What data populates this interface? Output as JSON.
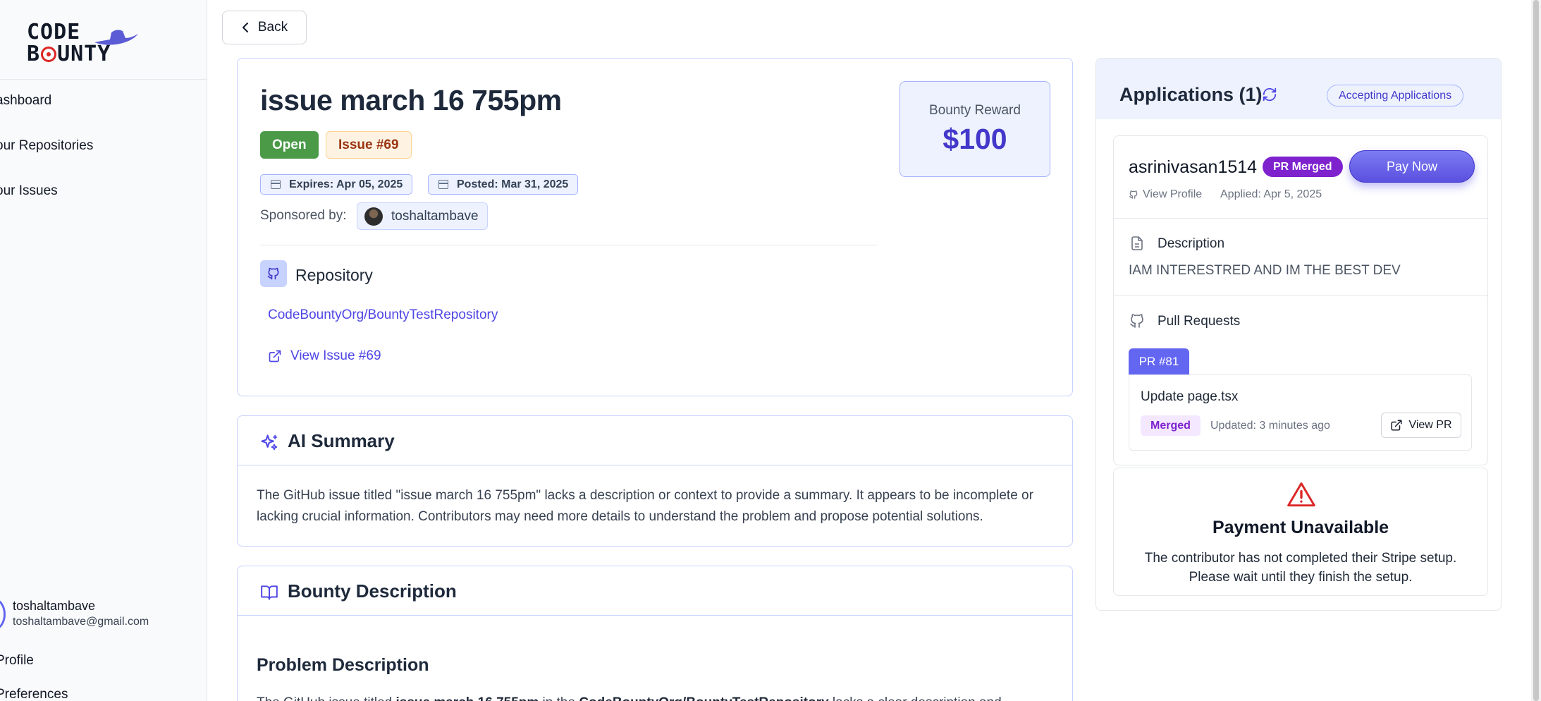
{
  "sidebar": {
    "logo_line1": "CODE",
    "logo_b": "B",
    "logo_rest": "UNTY",
    "nav": [
      "ashboard",
      "our Repositories",
      "our Issues"
    ],
    "user": {
      "name": "toshaltambave",
      "email": "toshaltambave@gmail.com"
    },
    "bottom_nav": [
      "Profile",
      "Preferences"
    ]
  },
  "back_label": "Back",
  "issue": {
    "title": "issue march 16 755pm",
    "status": "Open",
    "number_label": "Issue #69",
    "expires": "Expires: Apr 05, 2025",
    "posted": "Posted: Mar 31, 2025",
    "sponsored_label": "Sponsored by:",
    "sponsor": "toshaltambave",
    "repo_heading": "Repository",
    "repo_name": "CodeBountyOrg/BountyTestRepository",
    "view_issue": "View Issue #69",
    "bounty_label": "Bounty Reward",
    "bounty_amount": "$100"
  },
  "ai_summary": {
    "title": "AI Summary",
    "text": "The GitHub issue titled \"issue march 16 755pm\" lacks a description or context to provide a summary. It appears to be incomplete or lacking crucial information. Contributors may need more details to understand the problem and propose potential solutions."
  },
  "bounty_description": {
    "title": "Bounty Description",
    "heading": "Problem Description",
    "text_prefix": "The GitHub issue titled ",
    "text_bold1": "issue march 16 755pm",
    "text_mid": " in the ",
    "text_bold2": "CodeBountyOrg/BountyTestRepository",
    "text_suffix": " lacks a clear description and"
  },
  "applications": {
    "title": "Applications (1)",
    "status": "Accepting Applications",
    "applicant": {
      "name": "asrinivasan1514",
      "badge": "PR Merged",
      "pay_button": "Pay Now",
      "view_profile": "View Profile",
      "applied": "Applied: Apr 5, 2025",
      "description_heading": "Description",
      "description": "IAM INTERESTRED AND IM THE BEST DEV",
      "pr_heading": "Pull Requests",
      "pr": {
        "tab": "PR #81",
        "title": "Update page.tsx",
        "state": "Merged",
        "updated": "Updated: 3 minutes ago",
        "view": "View PR"
      }
    },
    "payment": {
      "title": "Payment Unavailable",
      "line1": "The contributor has not completed their Stripe setup.",
      "line2": "Please wait until they finish the setup."
    }
  },
  "colors": {
    "accent": "#4f46e5",
    "open_green": "#4a9a48",
    "merged_purple": "#7e22ce",
    "warning_red": "#dc2626"
  }
}
